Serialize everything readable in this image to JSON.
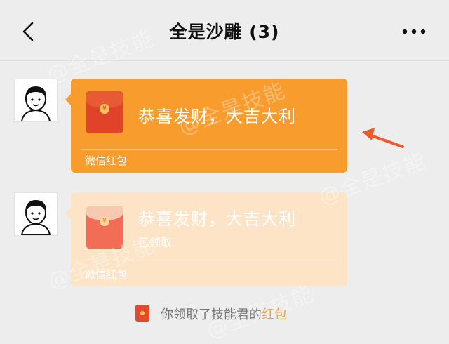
{
  "header": {
    "title": "全是沙雕 (3)"
  },
  "messages": [
    {
      "title": "恭喜发财，大吉大利",
      "status": "",
      "footer": "微信红包",
      "state": "unopened",
      "bubble_color": "#f89c2e"
    },
    {
      "title": "恭喜发财，大吉大利",
      "status": "已领取",
      "footer": "微信红包",
      "state": "claimed",
      "bubble_color": "#fde4c6"
    }
  ],
  "notice": {
    "prefix": "你领取了技能君的",
    "link": "红包"
  },
  "watermark": "@全是技能",
  "icons": {
    "envelope_symbol": "¥"
  },
  "colors": {
    "accent_arrow": "#f05a2a",
    "link": "#f0a032"
  }
}
